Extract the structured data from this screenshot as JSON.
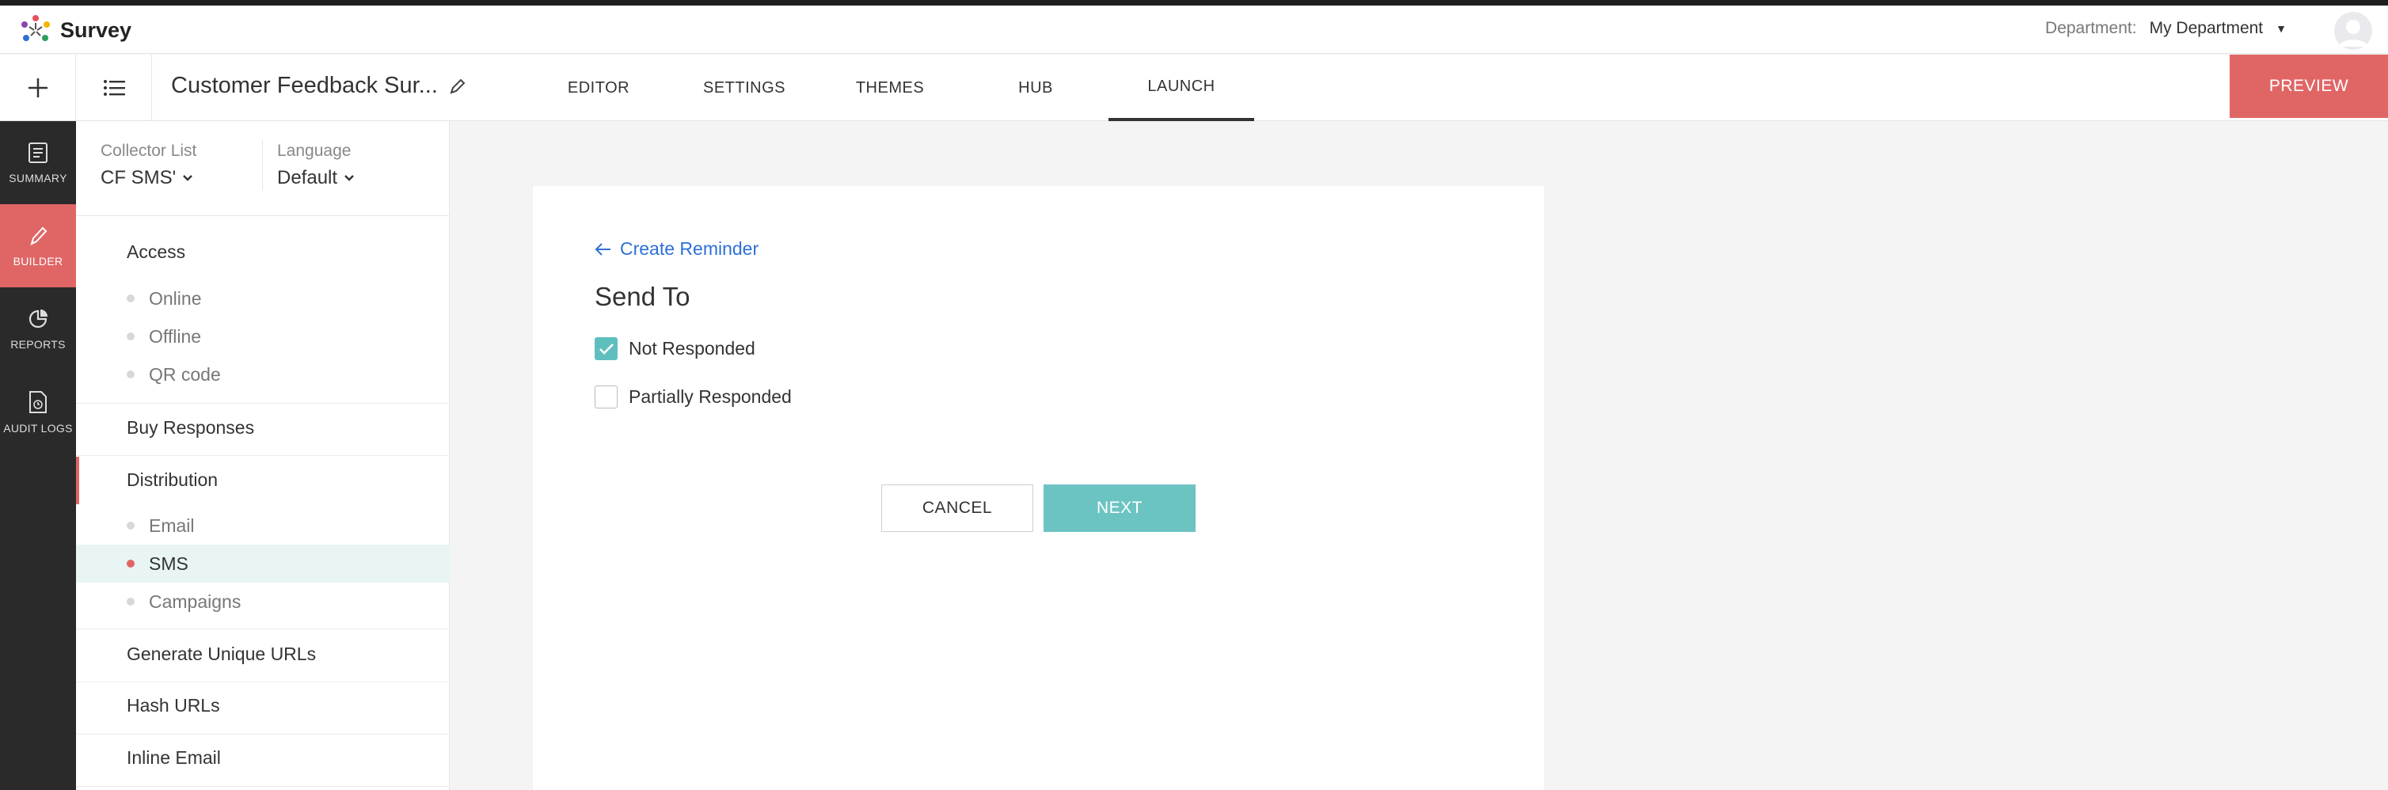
{
  "brand": {
    "name": "Survey"
  },
  "department": {
    "label": "Department:",
    "value": "My Department"
  },
  "toolbar": {
    "survey_title": "Customer Feedback Sur...",
    "tabs": [
      "EDITOR",
      "SETTINGS",
      "THEMES",
      "HUB",
      "LAUNCH"
    ],
    "active_tab": "LAUNCH",
    "preview_label": "PREVIEW"
  },
  "rail": {
    "items": [
      {
        "label": "SUMMARY",
        "icon": "summary-icon"
      },
      {
        "label": "BUILDER",
        "icon": "pencil-icon"
      },
      {
        "label": "REPORTS",
        "icon": "pie-chart-icon"
      },
      {
        "label": "AUDIT LOGS",
        "icon": "audit-log-icon"
      }
    ],
    "active": "BUILDER"
  },
  "sidebar": {
    "collector": {
      "label": "Collector List",
      "value": "CF SMS'"
    },
    "language": {
      "label": "Language",
      "value": "Default"
    },
    "access": {
      "heading": "Access",
      "items": [
        "Online",
        "Offline",
        "QR code"
      ]
    },
    "buy_responses": "Buy Responses",
    "distribution": {
      "heading": "Distribution",
      "items": [
        "Email",
        "SMS",
        "Campaigns"
      ],
      "active": "SMS"
    },
    "generate_unique_urls": "Generate Unique URLs",
    "hash_urls": "Hash URLs",
    "inline_email": "Inline Email"
  },
  "main": {
    "back_link": "Create Reminder",
    "heading": "Send To",
    "options": [
      {
        "label": "Not Responded",
        "checked": true
      },
      {
        "label": "Partially Responded",
        "checked": false
      }
    ],
    "cancel_label": "CANCEL",
    "next_label": "NEXT"
  },
  "colors": {
    "accent": "#e06666",
    "teal": "#6cc4c2",
    "link": "#2e6fd8",
    "rail": "#2a2a2a"
  }
}
